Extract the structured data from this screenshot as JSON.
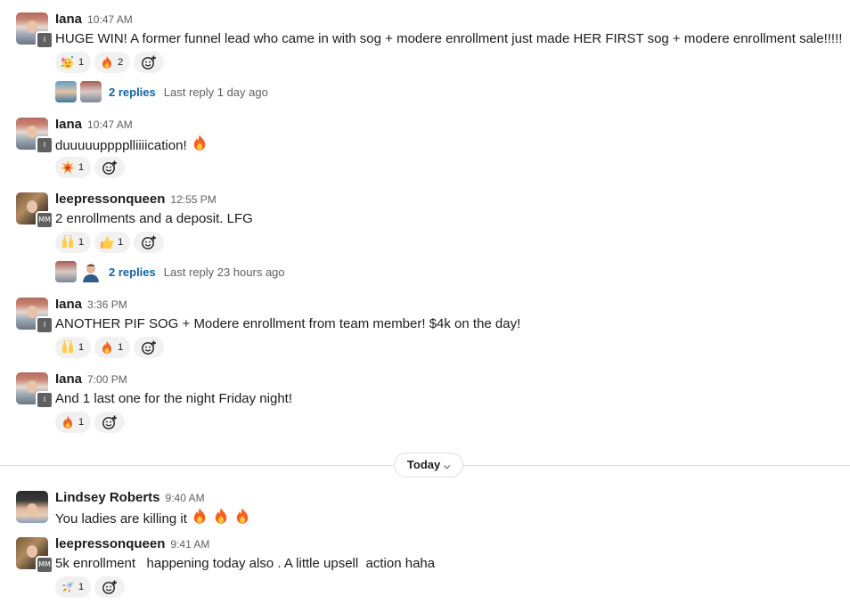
{
  "messages": [
    {
      "author": "Iana",
      "time": "10:47 AM",
      "badge": "I",
      "text": "HUGE WIN! A former funnel lead who came in with sog + modere enrollment just made HER FIRST sog + modere enrollment sale!!!!!",
      "reactions": [
        {
          "emoji": "partying-face",
          "count": "1"
        },
        {
          "emoji": "fire",
          "count": "2"
        }
      ],
      "thread": {
        "replies": "2 replies",
        "last": "Last reply 1 day ago"
      }
    },
    {
      "author": "Iana",
      "time": "10:47 AM",
      "badge": "I",
      "text": "duuuuupppplliiiication!",
      "reactions": [
        {
          "emoji": "collision",
          "count": "1"
        }
      ]
    },
    {
      "author": "leepressonqueen",
      "time": "12:55 PM",
      "badge": "MM",
      "text": "2 enrollments and a deposit. LFG",
      "reactions": [
        {
          "emoji": "raised-hands",
          "count": "1"
        },
        {
          "emoji": "thumbs-up",
          "count": "1"
        }
      ],
      "thread": {
        "replies": "2 replies",
        "last": "Last reply 23 hours ago"
      }
    },
    {
      "author": "Iana",
      "time": "3:36 PM",
      "badge": "I",
      "text": "ANOTHER PIF SOG + Modere enrollment from team member! $4k on the day!",
      "reactions": [
        {
          "emoji": "raised-hands",
          "count": "1"
        },
        {
          "emoji": "fire",
          "count": "1"
        }
      ]
    },
    {
      "author": "Iana",
      "time": "7:00 PM",
      "badge": "I",
      "text": "And 1 last one for the night Friday night!",
      "reactions": [
        {
          "emoji": "fire",
          "count": "1"
        }
      ]
    },
    {
      "author": "Lindsey Roberts",
      "time": "9:40 AM",
      "text": "You ladies are killing it"
    },
    {
      "author": "leepressonqueen",
      "time": "9:41 AM",
      "badge": "MM",
      "text": "5k enrollment   happening today also . A little upsell  action haha",
      "reactions": [
        {
          "emoji": "rocket",
          "count": "1"
        }
      ]
    }
  ],
  "divider": {
    "label": "Today"
  },
  "colors": {
    "link": "#1264a3",
    "muted": "#616061",
    "pill": "#f1f1f1"
  }
}
